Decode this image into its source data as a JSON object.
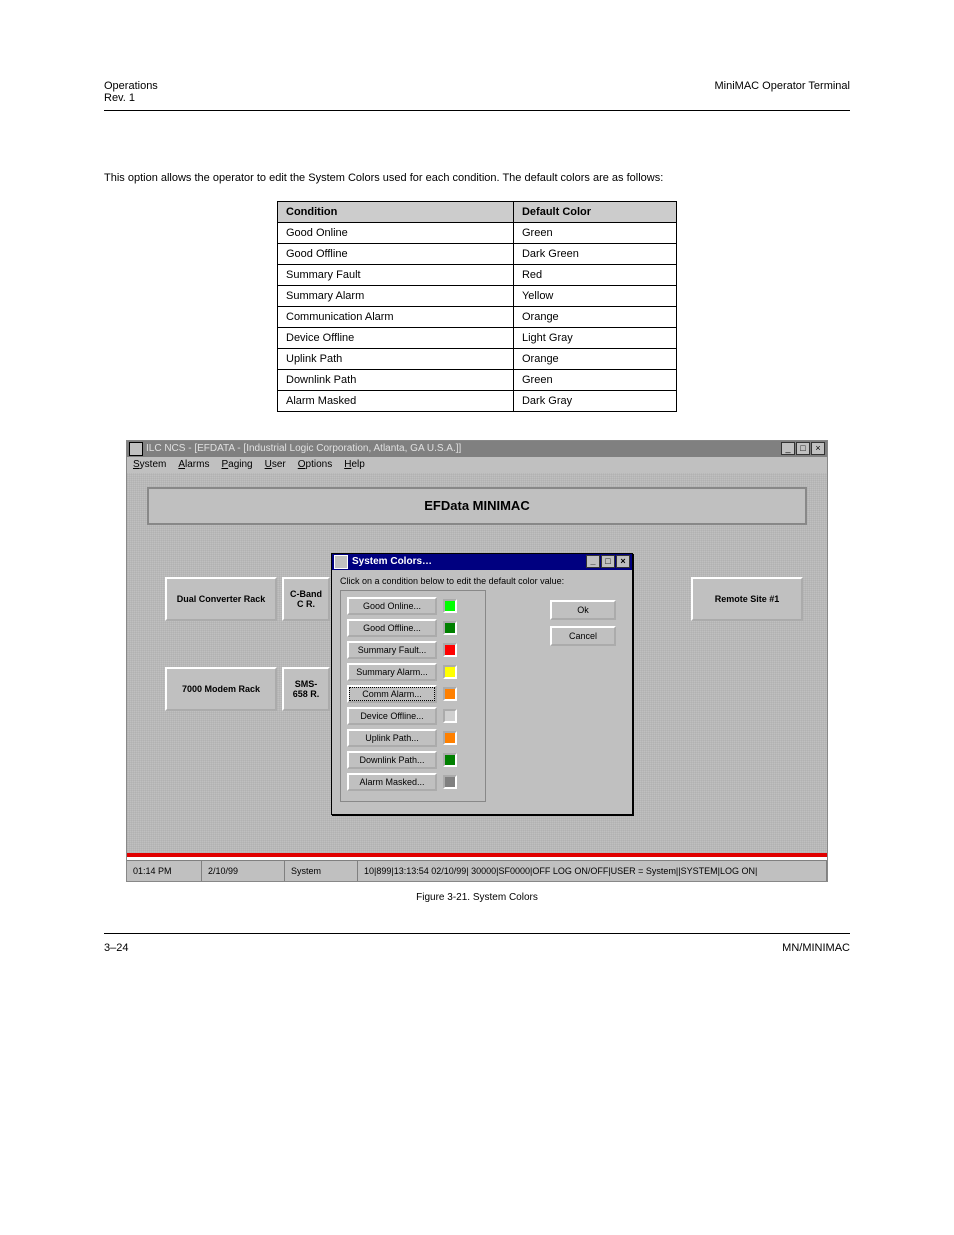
{
  "header": {
    "left": "Operations",
    "right": "MiniMAC Operator Terminal",
    "rev": "Rev. 1"
  },
  "body": {
    "para1": "This option allows the operator to edit the System Colors used for each condition. The default colors are as follows:"
  },
  "defaults_table": {
    "headers": [
      "Condition",
      "Default Color"
    ],
    "rows": [
      [
        "Good Online",
        "Green"
      ],
      [
        "Good Offline",
        "Dark Green"
      ],
      [
        "Summary Fault",
        "Red"
      ],
      [
        "Summary Alarm",
        "Yellow"
      ],
      [
        "Communication Alarm",
        "Orange"
      ],
      [
        "Device Offline",
        "Light Gray"
      ],
      [
        "Uplink Path",
        "Orange"
      ],
      [
        "Downlink Path",
        "Green"
      ],
      [
        "Alarm Masked",
        "Dark Gray"
      ]
    ]
  },
  "screenshot": {
    "app_title": "ILC NCS - [EFDATA - [Industrial Logic Corporation, Atlanta, GA U.S.A.]]",
    "menus": [
      "System",
      "Alarms",
      "Paging",
      "User",
      "Options",
      "Help"
    ],
    "banner": "EFData MINIMAC",
    "stations": {
      "dual": "Dual Converter Rack",
      "modem": "7000 Modem Rack",
      "cband": "C-Band C R.",
      "sms": "SMS-658 R.",
      "remote": "Remote Site #1"
    },
    "dialog": {
      "title": "System Colors…",
      "instruction": "Click on a condition below to edit the default color value:",
      "ok": "Ok",
      "cancel": "Cancel",
      "conditions": [
        {
          "label": "Good Online...",
          "color": "#00ff00"
        },
        {
          "label": "Good Offline...",
          "color": "#008000"
        },
        {
          "label": "Summary Fault...",
          "color": "#ff0000"
        },
        {
          "label": "Summary Alarm...",
          "color": "#ffff00"
        },
        {
          "label": "Comm Alarm...",
          "color": "#ff8000",
          "focused": true
        },
        {
          "label": "Device Offline...",
          "color": "#d0d0d0"
        },
        {
          "label": "Uplink Path...",
          "color": "#ff8000"
        },
        {
          "label": "Downlink Path...",
          "color": "#008000"
        },
        {
          "label": "Alarm Masked...",
          "color": "#808080"
        }
      ]
    },
    "status": {
      "time": "01:14 PM",
      "date": "2/10/99",
      "user": "System",
      "msg": "10|899|13:13:54 02/10/99| 30000|SF0000|OFF LOG ON/OFF|USER = System||SYSTEM|LOG ON|"
    }
  },
  "caption": "Figure 3-21. System Colors",
  "footer": {
    "left": "3–24",
    "right": "MN/MINIMAC"
  }
}
